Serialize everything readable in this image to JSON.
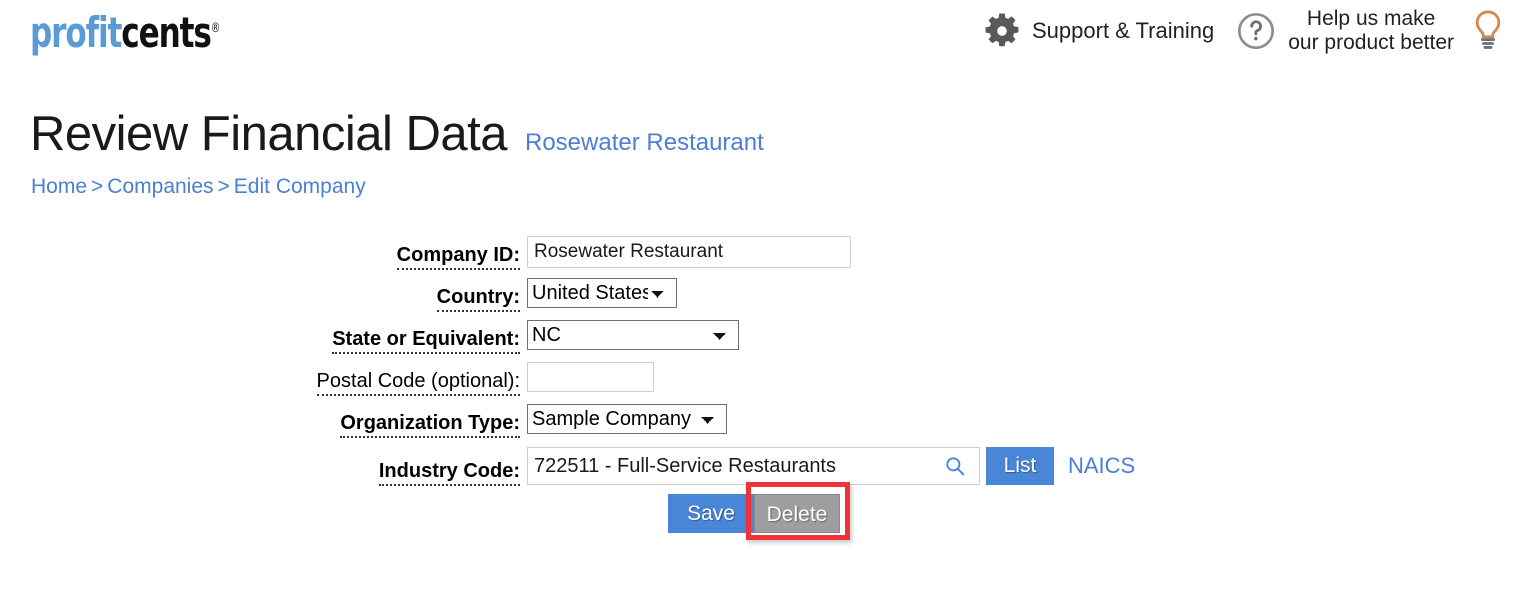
{
  "brand": {
    "logo_part1": "profit",
    "logo_part2": "cents",
    "logo_trademark": "®"
  },
  "header": {
    "gear_icon": "gear-icon",
    "support_label": "Support & Training",
    "question_icon": "question-circle-icon",
    "feedback_line1": "Help us make",
    "feedback_line2": "our product better",
    "bulb_icon": "lightbulb-icon"
  },
  "page": {
    "title": "Review Financial Data",
    "subtitle": "Rosewater Restaurant"
  },
  "breadcrumb": {
    "home": "Home",
    "sep1": ">",
    "companies": "Companies",
    "sep2": ">",
    "current": "Edit Company"
  },
  "form": {
    "company_id": {
      "label": "Company ID:",
      "value": "Rosewater Restaurant",
      "placeholder": ""
    },
    "country": {
      "label": "Country:",
      "value": "United States",
      "options": [
        "United States"
      ]
    },
    "state": {
      "label": "State or Equivalent:",
      "value": "NC",
      "options": [
        "NC"
      ]
    },
    "postal_code": {
      "label": "Postal Code (optional):",
      "value": "",
      "placeholder": ""
    },
    "organization_type": {
      "label": "Organization Type:",
      "value": "Sample Company",
      "options": [
        "Sample Company"
      ]
    },
    "industry_code": {
      "label": "Industry Code:",
      "value": "722511 - Full-Service Restaurants",
      "placeholder": "",
      "search_icon": "search-icon",
      "list_button": "List",
      "naics_link": "NAICS"
    }
  },
  "actions": {
    "save_label": "Save",
    "delete_label": "Delete"
  },
  "colors": {
    "accent_blue": "#4a86d8",
    "link_blue": "#4a7fd4",
    "logo_blue": "#5b9bd5",
    "delete_gray": "#9e9e9e",
    "highlight_red": "#ef3237"
  }
}
